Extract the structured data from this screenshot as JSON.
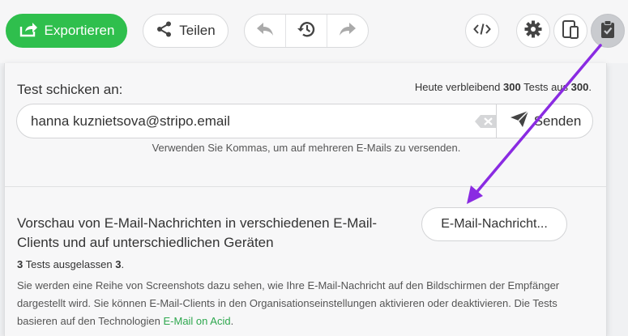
{
  "toolbar": {
    "export_label": "Exportieren",
    "share_label": "Teilen"
  },
  "test": {
    "send_to_label": "Test schicken an:",
    "remaining_prefix": "Heute verbleibend",
    "remaining_count": "300",
    "remaining_mid": "Tests aus",
    "remaining_total": "300",
    "remaining_suffix": ".",
    "email_value": "hanna kuznietsova@stripo.email",
    "send_label": "Senden",
    "hint": "Verwenden Sie Kommas, um auf mehreren E-Mails zu versenden."
  },
  "preview": {
    "title": "Vorschau von E-Mail-Nachrichten in verschiedenen E-Mail-Clients und auf unterschiedlichen Geräten",
    "button_label": "E-Mail-Nachricht...",
    "skipped_count": "3",
    "skipped_text": "Tests ausgelassen",
    "skipped_value": "3",
    "skipped_suffix": ".",
    "description_text": "Sie werden eine Reihe von Screenshots dazu sehen, wie Ihre E-Mail-Nachricht auf den Bildschirmen der Empfänger dargestellt wird. Sie können E-Mail-Clients in den Organisationseinstellungen aktivieren oder deaktivieren. Die Tests basieren auf den Technologien",
    "link_label": "E-Mail on Acid",
    "description_end": "."
  },
  "icons": [
    "export-icon",
    "share-icon",
    "undo-icon",
    "history-icon",
    "redo-icon",
    "code-icon",
    "gear-icon",
    "device-icon",
    "clipboard-check-icon",
    "clear-icon",
    "send-icon"
  ],
  "colors": {
    "accent_green": "#2fbf4d",
    "link_green": "#2fa84f",
    "annotation_arrow": "#8a2be2"
  }
}
